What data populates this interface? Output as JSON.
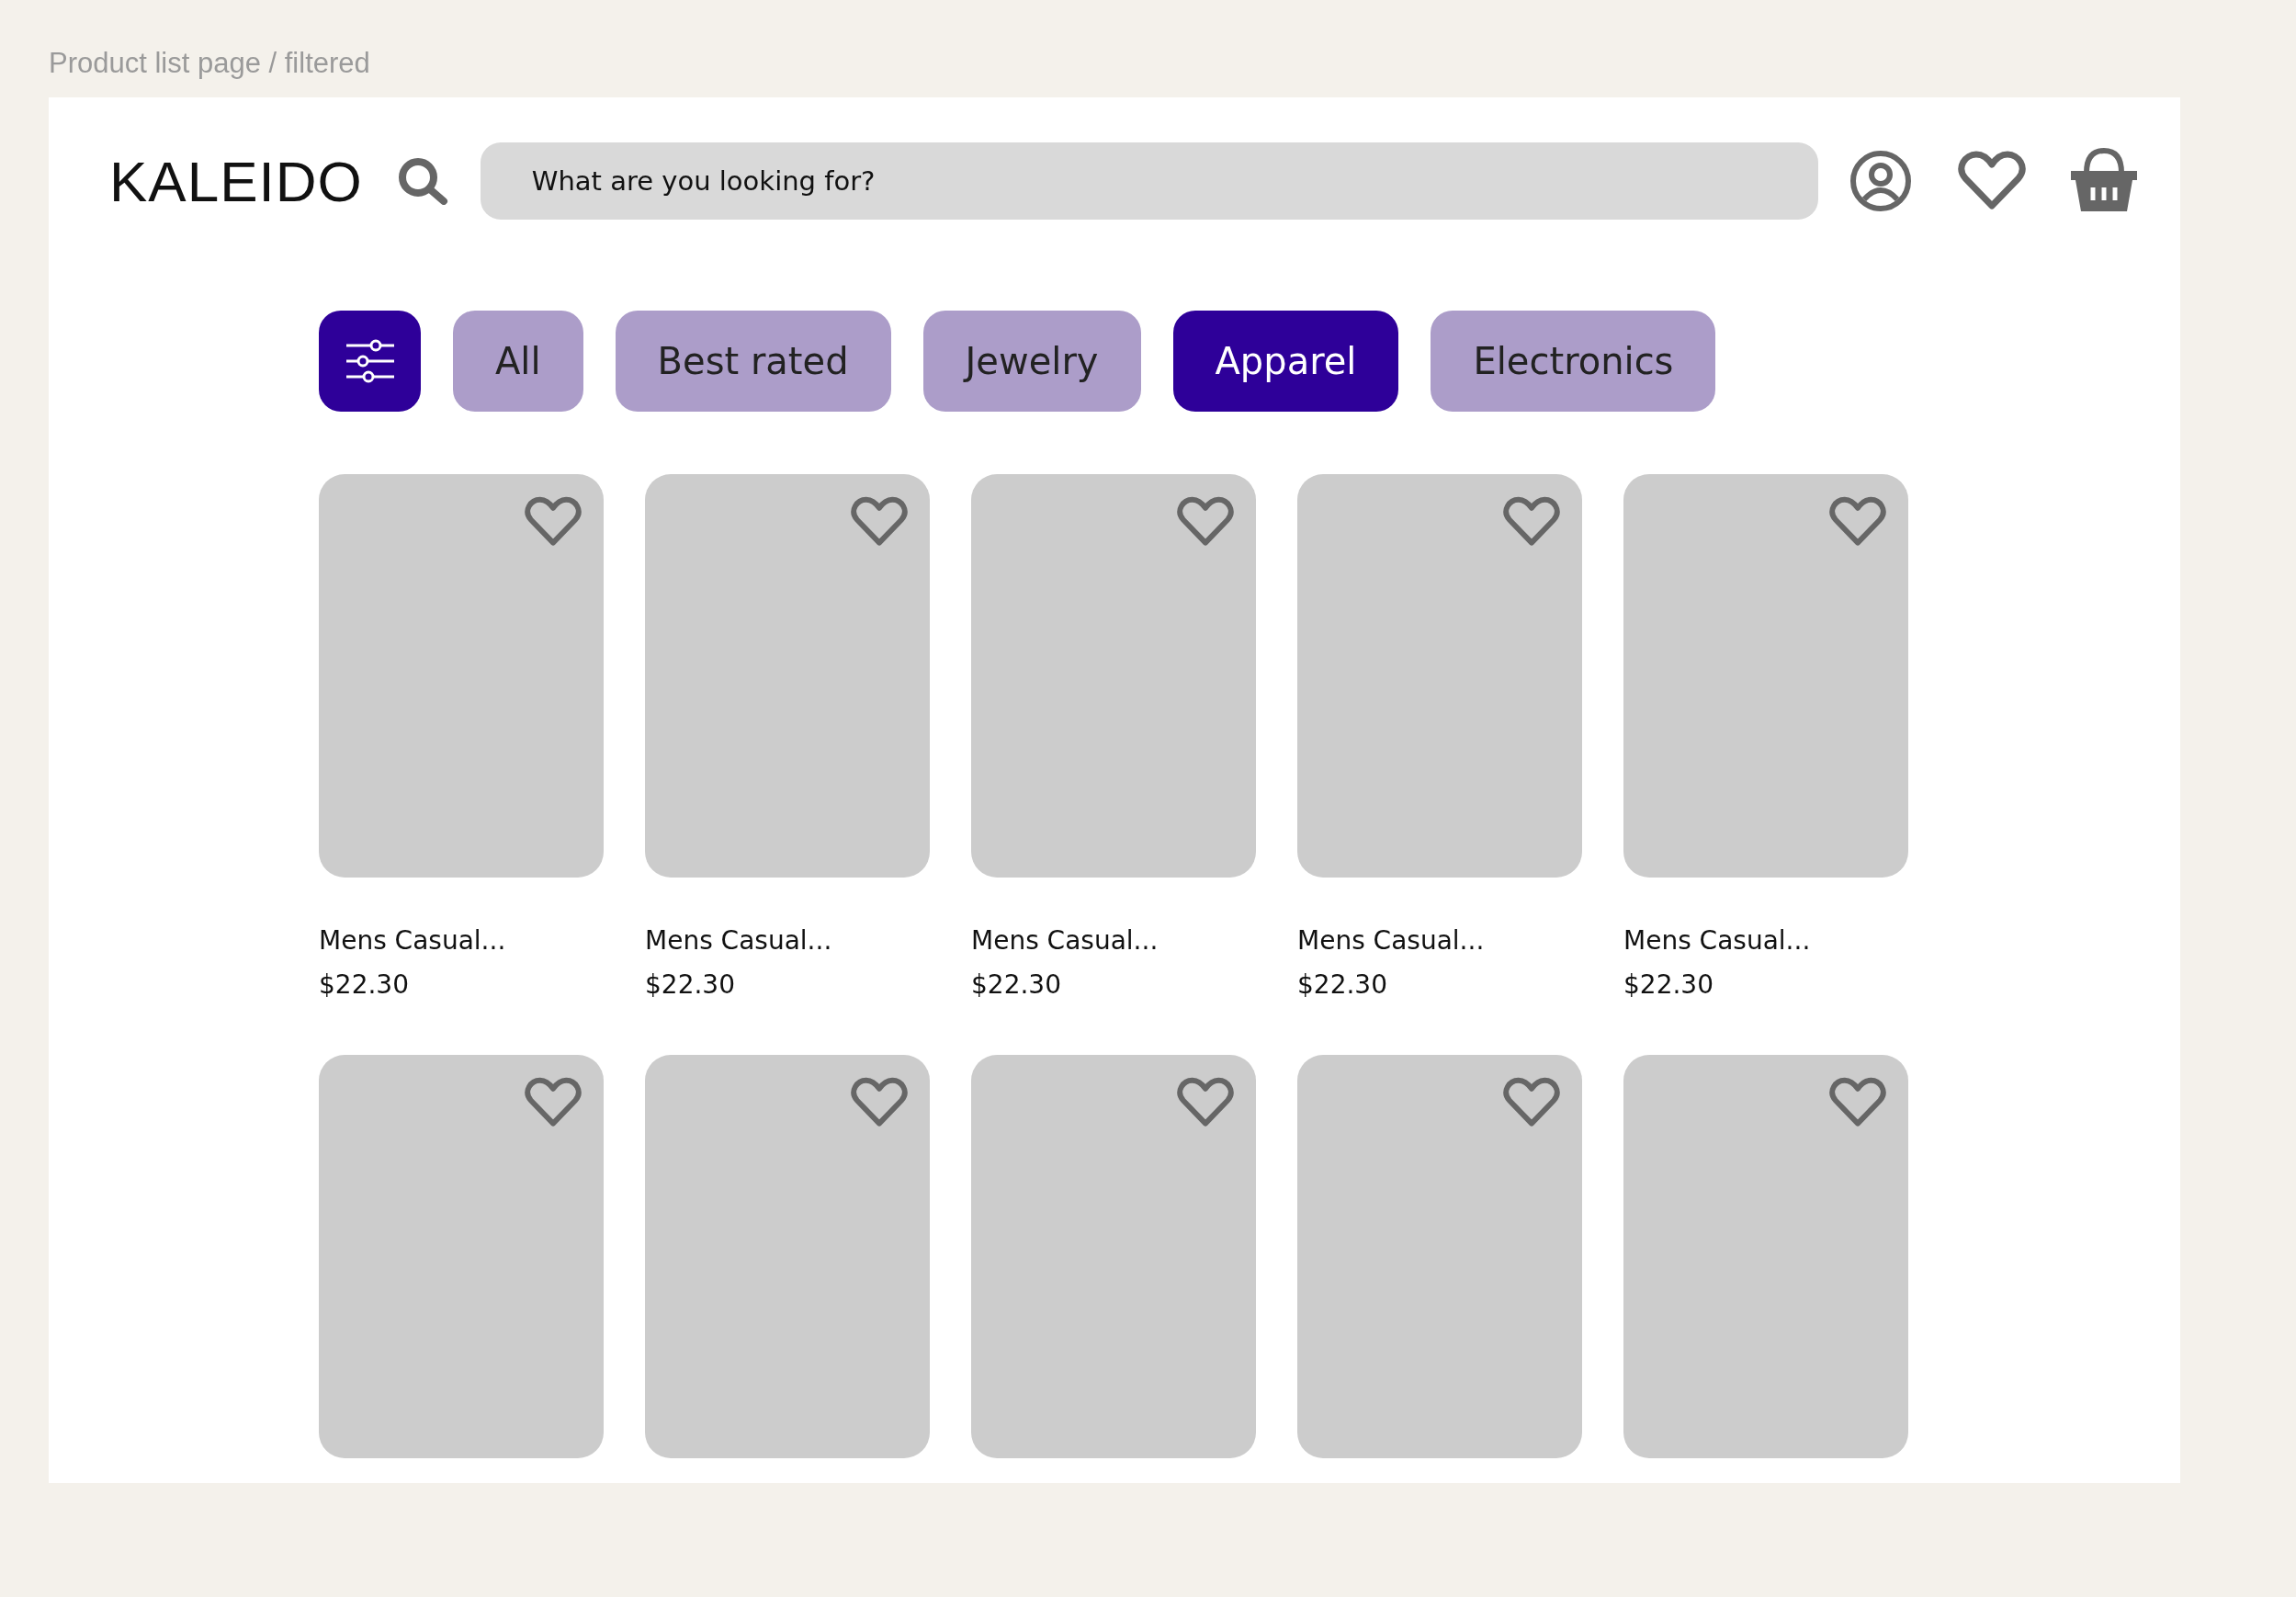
{
  "page_label": "Product list page / filtered",
  "header": {
    "logo": "KALEIDO",
    "search": {
      "placeholder": "What are you looking for?"
    }
  },
  "filters": [
    {
      "label": "All",
      "selected": false
    },
    {
      "label": "Best rated",
      "selected": false
    },
    {
      "label": "Jewelry",
      "selected": false
    },
    {
      "label": "Apparel",
      "selected": true
    },
    {
      "label": "Electronics",
      "selected": false
    }
  ],
  "products": [
    {
      "kind": "full",
      "name": "Mens Casual...",
      "price": "$22.30"
    },
    {
      "kind": "full",
      "name": "Mens Casual...",
      "price": "$22.30"
    },
    {
      "kind": "full",
      "name": "Mens Casual...",
      "price": "$22.30"
    },
    {
      "kind": "full",
      "name": "Mens Casual...",
      "price": "$22.30"
    },
    {
      "kind": "full",
      "name": "Mens Casual...",
      "price": "$22.30"
    },
    {
      "kind": "image_only"
    },
    {
      "kind": "image_only"
    },
    {
      "kind": "image_only"
    },
    {
      "kind": "image_only"
    },
    {
      "kind": "image_only"
    }
  ]
}
